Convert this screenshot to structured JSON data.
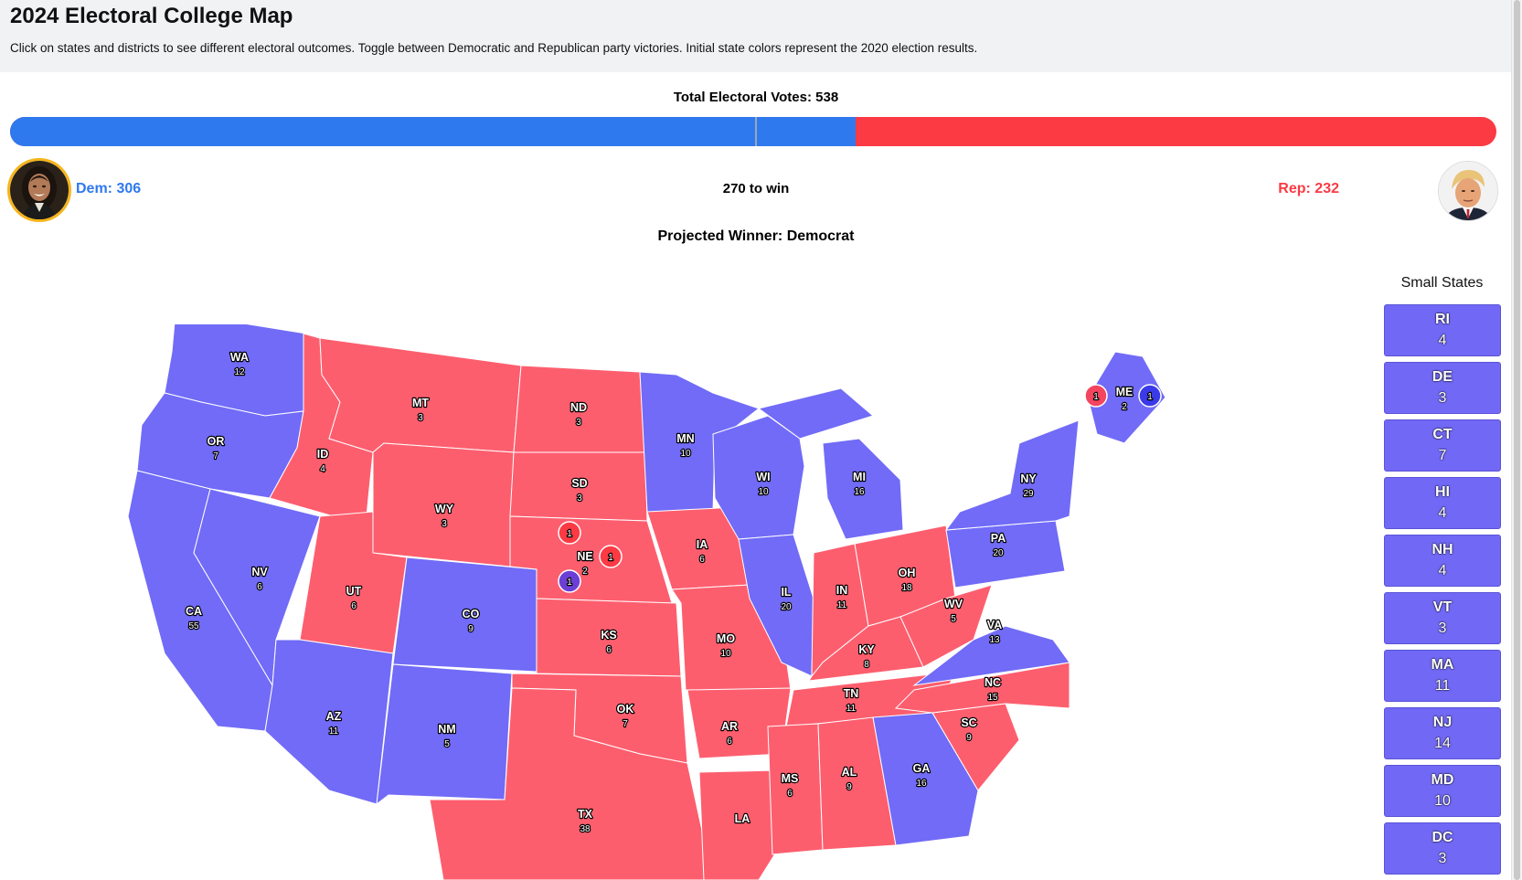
{
  "header": {
    "title": "2024 Electoral College Map",
    "description": "Click on states and districts to see different electoral outcomes. Toggle between Democratic and Republican party victories. Initial state colors represent the 2020 election results."
  },
  "totals": {
    "total_text": "Total Electoral Votes: 538",
    "dem_votes": 306,
    "rep_votes": 232,
    "total_votes": 538,
    "to_win": 270,
    "dem_label": "Dem: 306",
    "rep_label": "Rep: 232",
    "to_win_label": "270 to win",
    "winner_text": "Projected Winner: Democrat"
  },
  "colors": {
    "dem": "#2f79ee",
    "rep": "#fb3a44",
    "dem_state": "#716bf7",
    "rep_state": "#fd5e6e",
    "ne_district_dem": "#6b3fd6",
    "me_district_dem": "#3a3ae8",
    "me_district_rep": "#f4445f"
  },
  "map": {
    "states": [
      {
        "abbr": "WA",
        "ev": "12",
        "party": "dem"
      },
      {
        "abbr": "OR",
        "ev": "7",
        "party": "dem"
      },
      {
        "abbr": "CA",
        "ev": "55",
        "party": "dem"
      },
      {
        "abbr": "NV",
        "ev": "6",
        "party": "dem"
      },
      {
        "abbr": "ID",
        "ev": "4",
        "party": "rep"
      },
      {
        "abbr": "MT",
        "ev": "3",
        "party": "rep"
      },
      {
        "abbr": "WY",
        "ev": "3",
        "party": "rep"
      },
      {
        "abbr": "UT",
        "ev": "6",
        "party": "rep"
      },
      {
        "abbr": "CO",
        "ev": "9",
        "party": "dem"
      },
      {
        "abbr": "AZ",
        "ev": "11",
        "party": "dem"
      },
      {
        "abbr": "NM",
        "ev": "5",
        "party": "dem"
      },
      {
        "abbr": "ND",
        "ev": "3",
        "party": "rep"
      },
      {
        "abbr": "SD",
        "ev": "3",
        "party": "rep"
      },
      {
        "abbr": "NE",
        "ev": "2",
        "party": "rep"
      },
      {
        "abbr": "KS",
        "ev": "6",
        "party": "rep"
      },
      {
        "abbr": "OK",
        "ev": "7",
        "party": "rep"
      },
      {
        "abbr": "TX",
        "ev": "38",
        "party": "rep"
      },
      {
        "abbr": "MN",
        "ev": "10",
        "party": "dem"
      },
      {
        "abbr": "IA",
        "ev": "6",
        "party": "rep"
      },
      {
        "abbr": "MO",
        "ev": "10",
        "party": "rep"
      },
      {
        "abbr": "AR",
        "ev": "6",
        "party": "rep"
      },
      {
        "abbr": "LA",
        "ev": "",
        "party": "rep"
      },
      {
        "abbr": "WI",
        "ev": "10",
        "party": "dem"
      },
      {
        "abbr": "IL",
        "ev": "20",
        "party": "dem"
      },
      {
        "abbr": "MI",
        "ev": "16",
        "party": "dem"
      },
      {
        "abbr": "IN",
        "ev": "11",
        "party": "rep"
      },
      {
        "abbr": "OH",
        "ev": "18",
        "party": "rep"
      },
      {
        "abbr": "KY",
        "ev": "8",
        "party": "rep"
      },
      {
        "abbr": "TN",
        "ev": "11",
        "party": "rep"
      },
      {
        "abbr": "MS",
        "ev": "6",
        "party": "rep"
      },
      {
        "abbr": "AL",
        "ev": "9",
        "party": "rep"
      },
      {
        "abbr": "GA",
        "ev": "16",
        "party": "dem"
      },
      {
        "abbr": "SC",
        "ev": "9",
        "party": "rep"
      },
      {
        "abbr": "NC",
        "ev": "15",
        "party": "rep"
      },
      {
        "abbr": "VA",
        "ev": "13",
        "party": "dem"
      },
      {
        "abbr": "WV",
        "ev": "5",
        "party": "rep"
      },
      {
        "abbr": "PA",
        "ev": "20",
        "party": "dem"
      },
      {
        "abbr": "NY",
        "ev": "29",
        "party": "dem"
      },
      {
        "abbr": "ME",
        "ev": "2",
        "party": "dem"
      }
    ],
    "districts": [
      {
        "label": "1",
        "state": "NE",
        "party": "rep"
      },
      {
        "label": "1",
        "state": "NE",
        "party": "rep"
      },
      {
        "label": "1",
        "state": "NE",
        "party": "dem"
      },
      {
        "label": "1",
        "state": "ME",
        "party": "rep"
      },
      {
        "label": "1",
        "state": "ME",
        "party": "dem"
      }
    ]
  },
  "small_states": {
    "title": "Small States",
    "items": [
      {
        "abbr": "RI",
        "ev": "4"
      },
      {
        "abbr": "DE",
        "ev": "3"
      },
      {
        "abbr": "CT",
        "ev": "7"
      },
      {
        "abbr": "HI",
        "ev": "4"
      },
      {
        "abbr": "NH",
        "ev": "4"
      },
      {
        "abbr": "VT",
        "ev": "3"
      },
      {
        "abbr": "MA",
        "ev": "11"
      },
      {
        "abbr": "NJ",
        "ev": "14"
      },
      {
        "abbr": "MD",
        "ev": "10"
      },
      {
        "abbr": "DC",
        "ev": "3"
      }
    ]
  }
}
